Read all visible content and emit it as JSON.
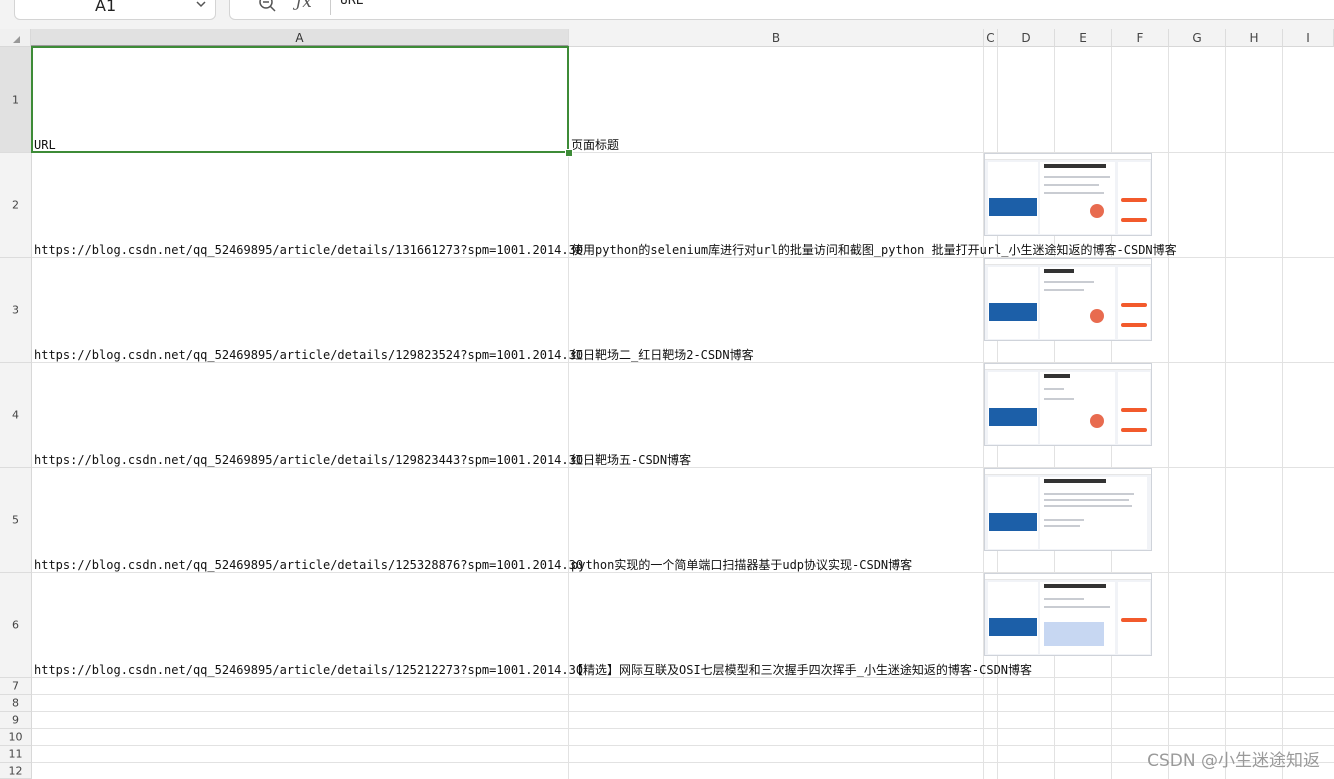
{
  "formula_bar": {
    "name_box": "A1",
    "formula_value": "URL"
  },
  "columns": [
    "A",
    "B",
    "C",
    "D",
    "E",
    "F",
    "G",
    "H",
    "I"
  ],
  "rows": [
    "1",
    "2",
    "3",
    "4",
    "5",
    "6",
    "7",
    "8",
    "9",
    "10",
    "11",
    "12"
  ],
  "cells": {
    "A1": "URL",
    "B1": "页面标题",
    "A2": "https://blog.csdn.net/qq_52469895/article/details/131661273?spm=1001.2014.30",
    "B2": "使用python的selenium库进行对url的批量访问和截图_python 批量打开url_小生迷途知返的博客-CSDN博客",
    "A3": "https://blog.csdn.net/qq_52469895/article/details/129823524?spm=1001.2014.30",
    "B3": "红日靶场二_红日靶场2-CSDN博客",
    "A4": "https://blog.csdn.net/qq_52469895/article/details/129823443?spm=1001.2014.30",
    "B4": "红日靶场五-CSDN博客",
    "A5": "https://blog.csdn.net/qq_52469895/article/details/125328876?spm=1001.2014.30",
    "B5": "python实现的一个简单端口扫描器基于udp协议实现-CSDN博客",
    "A6": "https://blog.csdn.net/qq_52469895/article/details/125212273?spm=1001.2014.30",
    "B6": "【精选】网际互联及OSI七层模型和三次握手四次挥手_小生迷途知返的博客-CSDN博客"
  },
  "icons": {
    "name_box_dropdown": "chevron-down-icon",
    "zoom": "zoom-out-icon",
    "fx": "function-icon",
    "select_all": "select-all-icon"
  },
  "fx_symbol": "ƒx",
  "accent_color": "#3d8b37",
  "watermark": "CSDN @小生迷途知返"
}
